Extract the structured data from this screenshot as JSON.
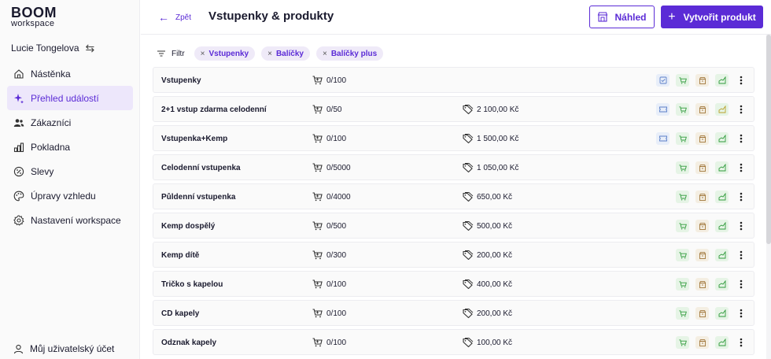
{
  "brand": {
    "name": "BOOM",
    "sub": "workspace"
  },
  "user": {
    "name": "Lucie Tongelova"
  },
  "nav": [
    {
      "label": "Nástěnka",
      "icon": "home-icon",
      "active": false
    },
    {
      "label": "Přehled událostí",
      "icon": "sparkle-icon",
      "active": true
    },
    {
      "label": "Zákazníci",
      "icon": "users-icon",
      "active": false
    },
    {
      "label": "Pokladna",
      "icon": "chart-icon",
      "active": false
    },
    {
      "label": "Slevy",
      "icon": "percent-icon",
      "active": false
    },
    {
      "label": "Úpravy vzhledu",
      "icon": "palette-icon",
      "active": false
    },
    {
      "label": "Nastavení workspace",
      "icon": "gear-icon",
      "active": false
    }
  ],
  "account": {
    "label": "Můj uživatelský účet"
  },
  "header": {
    "back": "Zpět",
    "title": "Vstupenky & produkty",
    "preview": "Náhled",
    "create": "Vytvořit produkt"
  },
  "filters": {
    "label": "Filtr",
    "chips": [
      "Vstupenky",
      "Balíčky",
      "Balíčky plus"
    ]
  },
  "colors": {
    "accent": "#5b2bd6",
    "green": "#2e9a3a",
    "brown": "#a0763a",
    "blue": "#5a7fc8"
  },
  "rows": [
    {
      "name": "Vstupenky",
      "qty": "0/100",
      "price": "",
      "badges": [
        "check",
        "cart",
        "box",
        "chart"
      ]
    },
    {
      "name": "2+1 vstup zdarma celodenní",
      "qty": "0/50",
      "price": "2 100,00 Kč",
      "badges": [
        "ticket",
        "cart",
        "box",
        "chart-yellow"
      ]
    },
    {
      "name": "Vstupenka+Kemp",
      "qty": "0/100",
      "price": "1 500,00 Kč",
      "badges": [
        "ticket",
        "cart",
        "box",
        "chart"
      ]
    },
    {
      "name": "Celodenní vstupenka",
      "qty": "0/5000",
      "price": "1 050,00 Kč",
      "badges": [
        "",
        "cart",
        "box",
        "chart"
      ]
    },
    {
      "name": "Půldenní vstupenka",
      "qty": "0/4000",
      "price": "650,00 Kč",
      "badges": [
        "",
        "cart",
        "box",
        "chart"
      ]
    },
    {
      "name": "Kemp dospělý",
      "qty": "0/500",
      "price": "500,00 Kč",
      "badges": [
        "",
        "cart",
        "box",
        "chart"
      ]
    },
    {
      "name": "Kemp dítě",
      "qty": "0/300",
      "price": "200,00 Kč",
      "badges": [
        "",
        "cart",
        "box",
        "chart"
      ]
    },
    {
      "name": "Tričko s kapelou",
      "qty": "0/100",
      "price": "400,00 Kč",
      "badges": [
        "",
        "cart",
        "box",
        "chart"
      ]
    },
    {
      "name": "CD kapely",
      "qty": "0/100",
      "price": "200,00 Kč",
      "badges": [
        "",
        "cart",
        "box",
        "chart"
      ]
    },
    {
      "name": "Odznak kapely",
      "qty": "0/100",
      "price": "100,00 Kč",
      "badges": [
        "",
        "cart",
        "box",
        "chart"
      ]
    }
  ]
}
